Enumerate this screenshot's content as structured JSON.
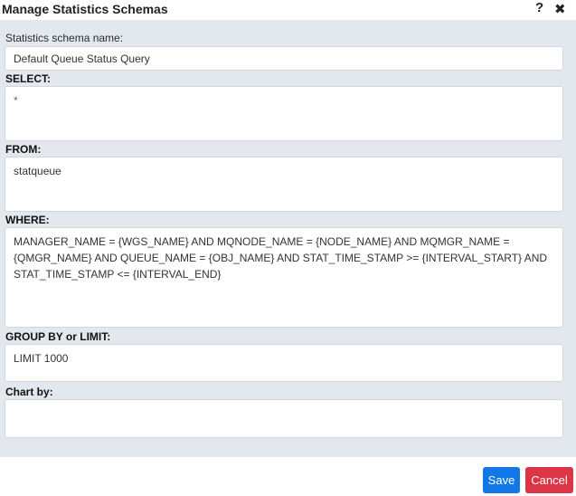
{
  "dialog": {
    "title": "Manage Statistics Schemas",
    "help_icon": "question-mark-icon",
    "close_icon": "close-icon"
  },
  "form": {
    "schema_name_label": "Statistics schema name:",
    "schema_name_value": "Default Queue Status Query",
    "select_label": "SELECT:",
    "select_value": "*",
    "from_label": "FROM:",
    "from_value": "statqueue",
    "where_label": "WHERE:",
    "where_value": "MANAGER_NAME = {WGS_NAME} AND MQNODE_NAME = {NODE_NAME} AND MQMGR_NAME = {QMGR_NAME} AND QUEUE_NAME = {OBJ_NAME} AND STAT_TIME_STAMP >= {INTERVAL_START} AND STAT_TIME_STAMP <= {INTERVAL_END}",
    "group_by_label": "GROUP BY or LIMIT:",
    "group_by_value": "LIMIT 1000",
    "chart_by_label": "Chart by:",
    "chart_by_value": ""
  },
  "footer": {
    "save_label": "Save",
    "cancel_label": "Cancel"
  },
  "colors": {
    "body_background": "#e3e8ef",
    "save_button": "#1278e8",
    "cancel_button": "#dc3545"
  }
}
